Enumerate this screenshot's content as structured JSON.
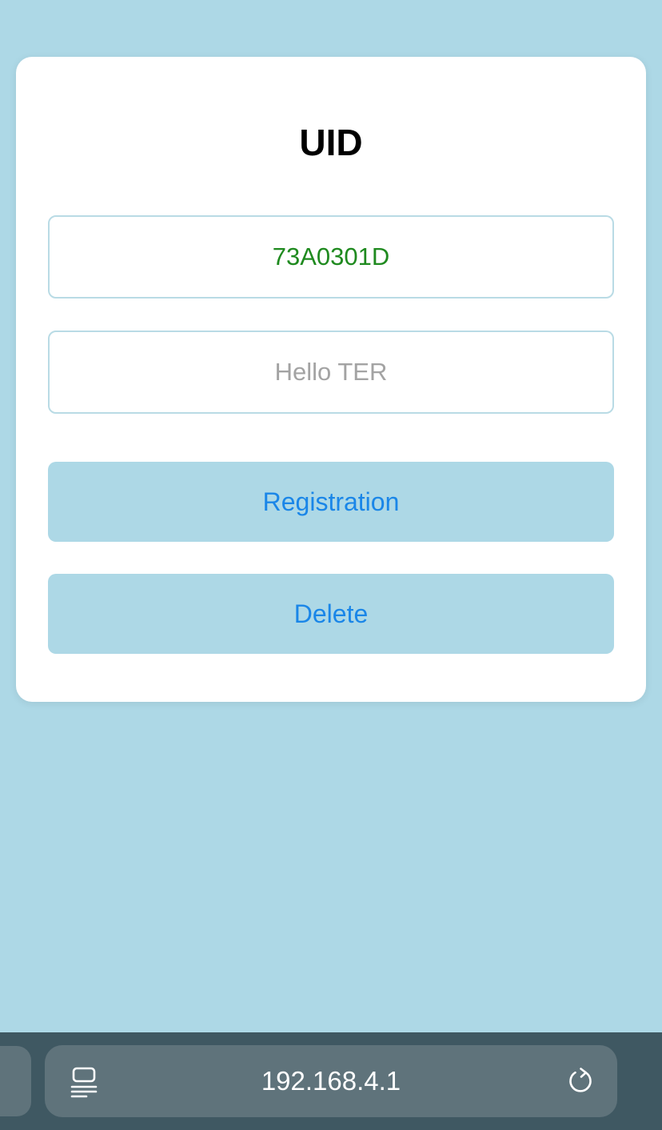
{
  "card": {
    "title": "UID",
    "uid_field": {
      "value": "73A0301D"
    },
    "name_field": {
      "value": "",
      "placeholder": "Hello TER"
    },
    "register_button": {
      "label": "Registration"
    },
    "delete_button": {
      "label": "Delete"
    }
  },
  "browser_toolbar": {
    "url": "192.168.4.1",
    "icons": {
      "page_menu": "page-menu-icon",
      "reload": "reload-icon"
    }
  },
  "colors": {
    "page_background": "#add8e6",
    "card_background": "#ffffff",
    "uid_text": "#1f8a1f",
    "button_background": "#add8e6",
    "button_text": "#1a86e8",
    "toolbar_background": "#3f5862",
    "address_bar_background": "#5f737b"
  }
}
